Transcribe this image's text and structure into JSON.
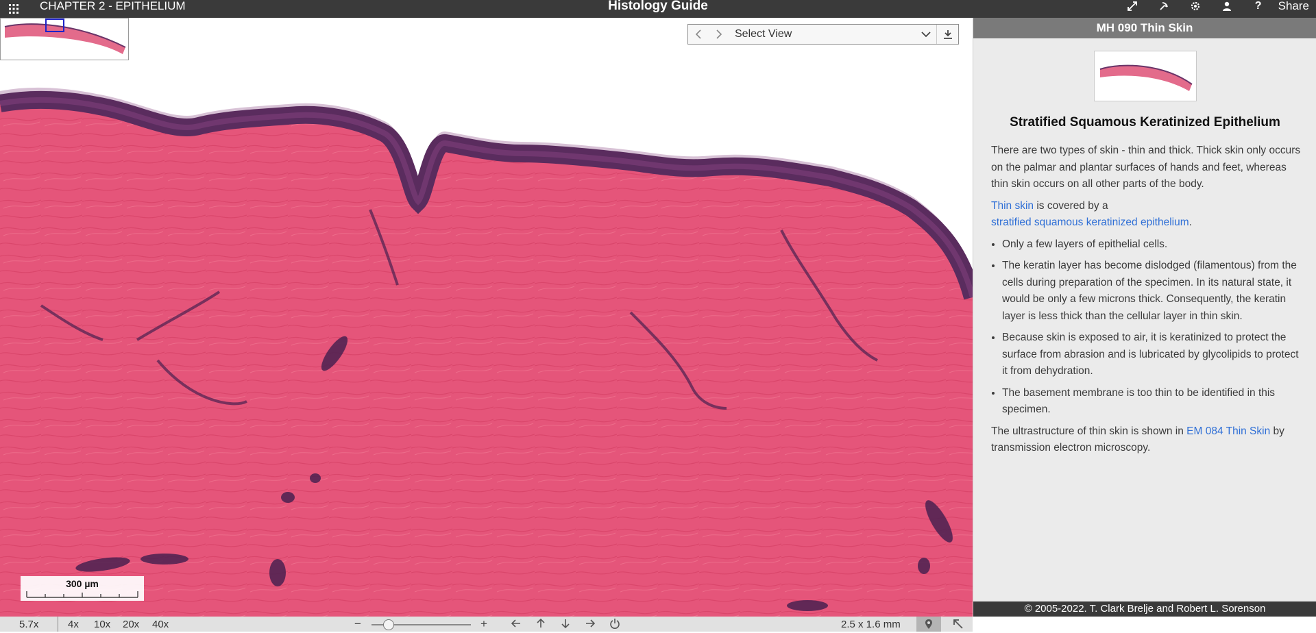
{
  "header": {
    "chapter": "CHAPTER 2 - EPITHELIUM",
    "app_title": "Histology Guide",
    "share_label": "Share",
    "icons": [
      "fullscreen-icon",
      "pointer-icon",
      "settings-icon",
      "user-icon",
      "help-icon"
    ]
  },
  "viewer": {
    "select_view_label": "Select View",
    "scale_label": "300 µm"
  },
  "bottom_bar": {
    "zoom_value": "5.7x",
    "zoom_presets": [
      "4x",
      "10x",
      "20x",
      "40x"
    ],
    "zoom_out": "−",
    "zoom_in": "+",
    "zoom_level": 0.12,
    "dimensions": "2.5 x 1.6 mm"
  },
  "panel": {
    "slide_title": "MH 090 Thin Skin",
    "heading": "Stratified Squamous Keratinized Epithelium",
    "intro": "There are two types of skin - thin and thick. Thick skin only occurs on the palmar and plantar surfaces of hands and feet, whereas thin skin occurs on all other parts of the body.",
    "covered_link": "Thin skin",
    "covered_text": " is covered by a ",
    "covered_link2": "stratified squamous keratinized epithelium",
    "covered_end": ".",
    "bullets": [
      "Only a few layers of epithelial cells.",
      "The keratin layer has become dislodged (filamentous) from the cells during preparation of the specimen. In its natural state, it would be only a few microns thick. Consequently, the keratin layer is less thick than the cellular layer in thin skin.",
      "Because skin is exposed to air, it is keratinized to protect the surface from abrasion and is lubricated by glycolipids to protect it from dehydration.",
      "The basement membrane is too thin to be identified in this specimen."
    ],
    "ultra_text": "The ultrastructure of thin skin is shown in ",
    "ultra_link": "EM 084 Thin Skin",
    "ultra_end": " by transmission electron microscopy.",
    "footer": "© 2005-2022. T. Clark Brelje and Robert L. Sorenson"
  }
}
